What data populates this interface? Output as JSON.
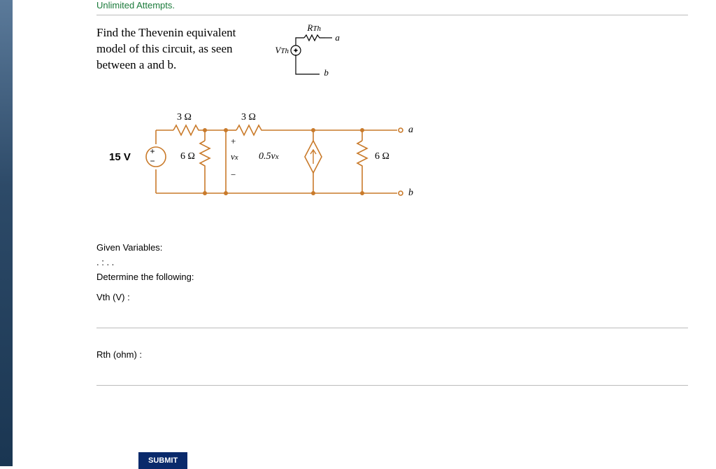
{
  "attempts_label": "Unlimited Attempts.",
  "prompt": {
    "line1": "Find the Thevenin equivalent",
    "line2": "model of this circuit, as seen",
    "line3": "between a and b."
  },
  "thev": {
    "Rth": "R",
    "Rth_sub": "Th",
    "Vth": "V",
    "Vth_sub": "Th",
    "a": "a",
    "b": "b"
  },
  "circuit": {
    "v_src": "15 V",
    "r1": "3 Ω",
    "r2": "3 Ω",
    "r3": "6 Ω",
    "r4": "6 Ω",
    "vx": "v",
    "vx_sub": "x",
    "dep": "0.5v",
    "dep_sub": "x",
    "a": "a",
    "b": "b",
    "plus": "+",
    "minus": "−"
  },
  "text": {
    "given": "Given Variables:",
    "dots": ". : . .",
    "determine": "Determine the following:",
    "vth_field": "Vth (V) :",
    "rth_field": "Rth (ohm) :",
    "submit": "SUBMIT"
  }
}
